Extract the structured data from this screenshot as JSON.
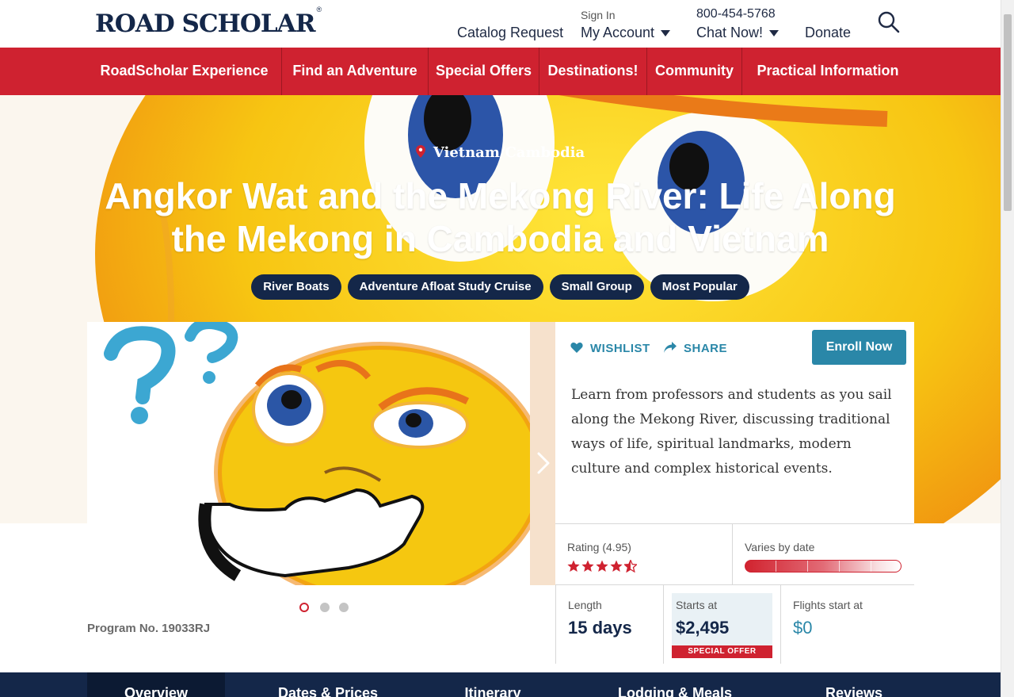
{
  "header": {
    "logo_text": "ROAD SCHOLAR",
    "logo_mark": "®",
    "catalog_request": "Catalog Request",
    "sign_in": "Sign In",
    "my_account": "My Account",
    "phone": "800-454-5768",
    "chat_now": "Chat Now!",
    "donate": "Donate",
    "search_icon": "search-icon"
  },
  "nav": {
    "items": [
      "RoadScholar Experience",
      "Find an Adventure",
      "Special Offers",
      "Destinations!",
      "Community",
      "Practical Information"
    ]
  },
  "hero": {
    "location": "Vietnam/Cambodia",
    "title": "Angkor Wat and the Mekong River: Life Along the Mekong in Cambodia and Vietnam",
    "tags": [
      "River Boats",
      "Adventure Afloat Study Cruise",
      "Small Group",
      "Most Popular"
    ]
  },
  "gallery": {
    "program_no": "Program No. 19033RJ",
    "slide_count": 3,
    "active_slide": 1
  },
  "info": {
    "wishlist": "WISHLIST",
    "share": "SHARE",
    "enroll": "Enroll Now",
    "description": "Learn from professors and students as you sail along the Mekong River, discussing traditional ways of life, spiritual landmarks, modern culture and complex historical events."
  },
  "stats": {
    "rating_label": "Rating (4.95)",
    "rating_value": 4.95,
    "price_label": "Varies by date",
    "length_label": "Length",
    "length_value": "15 days",
    "starts_label": "Starts at",
    "starts_value": "$2,495",
    "special_offer": "SPECIAL OFFER",
    "flights_label": "Flights start at",
    "flights_value": "$0"
  },
  "tabs": [
    "Overview",
    "Dates & Prices",
    "Itinerary",
    "Lodging & Meals",
    "Reviews"
  ],
  "colors": {
    "brand_navy": "#142749",
    "brand_red": "#cf2230",
    "accent_teal": "#2a87a8"
  }
}
